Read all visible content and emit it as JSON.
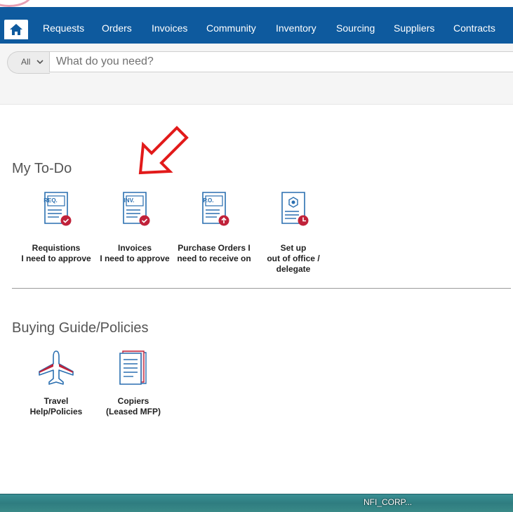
{
  "nav": {
    "home_icon": "home-icon",
    "items": [
      "Requests",
      "Orders",
      "Invoices",
      "Community",
      "Inventory",
      "Sourcing",
      "Suppliers",
      "Contracts"
    ]
  },
  "search": {
    "scope": "All",
    "placeholder": "What do you need?"
  },
  "todo": {
    "title": "My To-Do",
    "tiles": [
      {
        "icon_text": "REQ.",
        "line1": "Requistions",
        "line2": "I need to approve",
        "line3": ""
      },
      {
        "icon_text": "INV.",
        "line1": "Invoices",
        "line2": "I need to approve",
        "line3": ""
      },
      {
        "icon_text": "P.O.",
        "line1": "Purchase Orders I",
        "line2": "need to receive on",
        "line3": ""
      },
      {
        "icon_text": "",
        "line1": "Set up",
        "line2": "out of office /",
        "line3": "delegate"
      }
    ]
  },
  "guide": {
    "title": "Buying Guide/Policies",
    "tiles": [
      {
        "line1": "Travel",
        "line2": "Help/Policies"
      },
      {
        "line1": "Copiers",
        "line2": "(Leased MFP)"
      }
    ]
  },
  "taskbar": {
    "text": "NFI_CORP..."
  },
  "colors": {
    "nav_bg": "#0e5a9e",
    "icon_blue": "#2a6fb0",
    "badge_red": "#c0223a",
    "arrow_red": "#e21a1a"
  }
}
